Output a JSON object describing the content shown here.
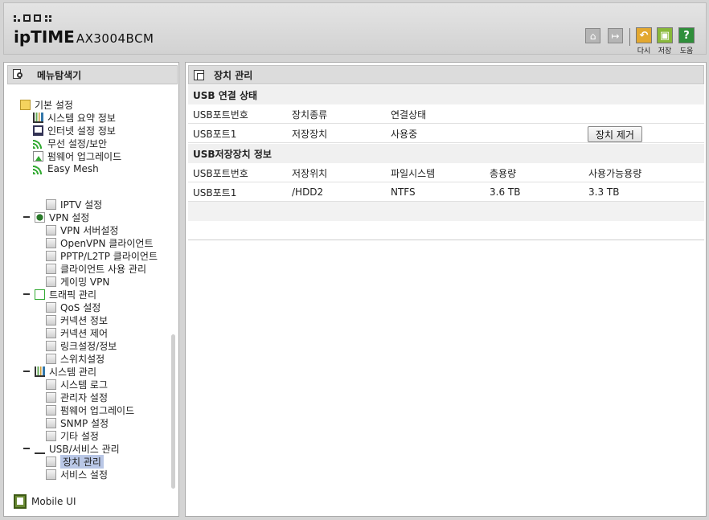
{
  "header": {
    "brand": "ipTIME",
    "model": "AX3004BCM",
    "reload_label": "다시",
    "save_label": "저장",
    "help_label": "도움",
    "help_glyph": "?"
  },
  "sidebar": {
    "title": "메뉴탐색기",
    "mobile_label": "Mobile UI",
    "tree": {
      "basic": "기본 설정",
      "sys_summary": "시스템 요약 정보",
      "internet": "인터넷 설정 정보",
      "wireless": "무선 설정/보안",
      "firmware_up": "펌웨어 업그레이드",
      "easymesh": "Easy Mesh",
      "iptv": "IPTV 설정",
      "vpn": "VPN 설정",
      "vpn_server": "VPN 서버설정",
      "openvpn": "OpenVPN 클라이언트",
      "pptp": "PPTP/L2TP 클라이언트",
      "client_mgmt": "클라이언트 사용 관리",
      "gaming_vpn": "게이밍 VPN",
      "traffic": "트래픽 관리",
      "qos": "QoS 설정",
      "conn_info": "커넥션 정보",
      "conn_ctrl": "커넥션 제어",
      "link": "링크설정/정보",
      "switch": "스위치설정",
      "system": "시스템 관리",
      "syslog": "시스템 로그",
      "admin": "관리자 설정",
      "fw_upgrade": "펌웨어 업그레이드",
      "snmp": "SNMP 설정",
      "etc": "기타 설정",
      "usb_service": "USB/서비스 관리",
      "device_mgmt": "장치 관리",
      "service": "서비스 설정"
    }
  },
  "main": {
    "title": "장치 관리",
    "usb_status": {
      "heading": "USB 연결 상태",
      "columns": [
        "USB포트번호",
        "장치종류",
        "연결상태"
      ],
      "rows": [
        [
          "USB포트1",
          "저장장치",
          "사용중"
        ]
      ],
      "remove_button": "장치 제거"
    },
    "storage": {
      "heading": "USB저장장치 정보",
      "columns": [
        "USB포트번호",
        "저장위치",
        "파일시스템",
        "총용량",
        "사용가능용량"
      ],
      "rows": [
        [
          "USB포트1",
          "/HDD2",
          "NTFS",
          "3.6 TB",
          "3.3 TB"
        ]
      ]
    }
  }
}
